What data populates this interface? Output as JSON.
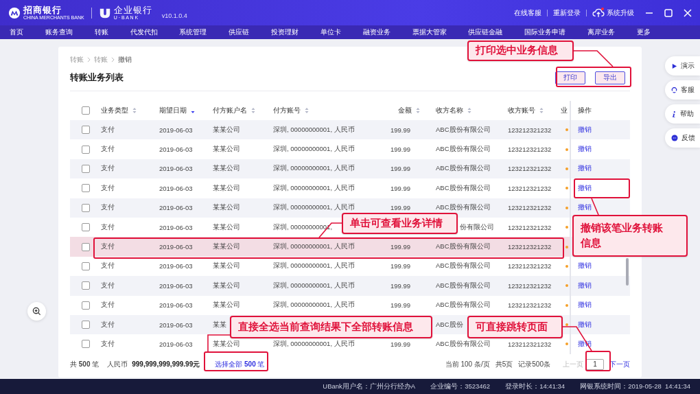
{
  "header": {
    "bank_name": "招商银行",
    "bank_sub": "CHINA MERCHANTS BANK",
    "product": "企业银行",
    "product_sub": "U · B A N K",
    "version": "v10.1.0.4",
    "links": [
      "在线客服",
      "重新登录"
    ],
    "upgrade": {
      "label": "系统升级",
      "notice": true
    }
  },
  "nav": [
    "首页",
    "账务查询",
    "转账",
    "代发代扣",
    "系统管理",
    "供应链",
    "投资理财",
    "单位卡",
    "融资业务",
    "票据大管家",
    "供应链金融",
    "国际业务申请",
    "离岸业务",
    "更多"
  ],
  "breadcrumb": [
    {
      "label": "转账",
      "current": false
    },
    {
      "label": "转账",
      "current": false
    },
    {
      "label": "撤销",
      "current": true
    }
  ],
  "page_title": "转账业务列表",
  "actions": [
    "打印",
    "导出"
  ],
  "table": {
    "select_all_checked": false,
    "columns": [
      {
        "label": "业务类型",
        "sorted": false
      },
      {
        "label": "期望日期",
        "sorted": true
      },
      {
        "label": "付方账户名",
        "sorted": false
      },
      {
        "label": "付方账号",
        "sorted": false
      },
      {
        "label": "金额",
        "sorted": false
      },
      {
        "label": "收方名称",
        "sorted": false
      },
      {
        "label": "收方账号",
        "sorted": false
      },
      {
        "label": "业"
      },
      {
        "label": "操作"
      }
    ],
    "rows": [
      {
        "type": "支付",
        "date": "2019-06-03",
        "payer_name": "某某公司",
        "payer_account": "深圳, 00000000001, 人民币",
        "amount": "199.99",
        "payee_name": "ABC股份有限公司",
        "payee_account": "123212321232",
        "color": "#f5a02a",
        "action": "撤销",
        "checked": false,
        "selected": false
      },
      {
        "type": "支付",
        "date": "2019-06-03",
        "payer_name": "某某公司",
        "payer_account": "深圳, 00000000001, 人民币",
        "amount": "199.99",
        "payee_name": "ABC股份有限公司",
        "payee_account": "123212321232",
        "color": "#f5a02a",
        "action": "撤销",
        "checked": false,
        "selected": false
      },
      {
        "type": "支付",
        "date": "2019-06-03",
        "payer_name": "某某公司",
        "payer_account": "深圳, 00000000001, 人民币",
        "amount": "199.99",
        "payee_name": "ABC股份有限公司",
        "payee_account": "123212321232",
        "color": "#f5a02a",
        "action": "撤销",
        "checked": false,
        "selected": false
      },
      {
        "type": "支付",
        "date": "2019-06-03",
        "payer_name": "某某公司",
        "payer_account": "深圳, 00000000001, 人民币",
        "amount": "199.99",
        "payee_name": "ABC股份有限公司",
        "payee_account": "123212321232",
        "color": "#f5a02a",
        "action": "撤销",
        "checked": false,
        "selected": false
      },
      {
        "type": "支付",
        "date": "2019-06-03",
        "payer_name": "某某公司",
        "payer_account": "深圳, 00000000001, 人民币",
        "amount": "199.99",
        "payee_name": "ABC股份有限公司",
        "payee_account": "123212321232",
        "color": "#f5a02a",
        "action": "撤销",
        "checked": false,
        "selected": false
      },
      {
        "type": "支付",
        "date": "2019-06-03",
        "payer_name": "某某公司",
        "payer_account": "深圳, 00000000001,",
        "payee_name": "份有限公司",
        "payee_name_cut_left": true,
        "payee_account": "123212321232",
        "color": "#f5a02a",
        "checked": false,
        "selected": false
      },
      {
        "type": "支付",
        "date": "2019-06-03",
        "payer_name": "某某公司",
        "payer_account": "深圳, 00000000001, 人民币",
        "amount": "199.99",
        "payee_name": "ABC股份有限公司",
        "payee_account": "123212321232",
        "color": "#f5a02a",
        "checked": false,
        "selected": true
      },
      {
        "type": "支付",
        "date": "2019-06-03",
        "payer_name": "某某公司",
        "payer_account": "深圳, 00000000001, 人民币",
        "amount": "199.99",
        "payee_name": "ABC股份有限公司",
        "payee_account": "123212321232",
        "color": "#f5a02a",
        "action": "撤销",
        "checked": false,
        "selected": false
      },
      {
        "type": "支付",
        "date": "2019-06-03",
        "payer_name": "某某公司",
        "payer_account": "深圳, 00000000001, 人民币",
        "amount": "199.99",
        "payee_name": "ABC股份有限公司",
        "payee_account": "123212321232",
        "color": "#f5a02a",
        "action": "撤销",
        "checked": false,
        "selected": false
      },
      {
        "type": "支付",
        "date": "2019-06-03",
        "payer_name": "某某公司",
        "payer_account": "深圳, 00000000001, 人民币",
        "amount": "199.99",
        "payee_name": "ABC股份有限公司",
        "payee_account": "123212321232",
        "color": "#f5a02a",
        "action": "撤销",
        "checked": false,
        "selected": false
      },
      {
        "type": "支付",
        "date": "2019-06-03",
        "payer_name": "某某",
        "payee_name": "ABC股份",
        "color": "#f5a02a",
        "action": "撤销",
        "checked": false,
        "selected": false
      },
      {
        "type": "支付",
        "date": "2019-06-03",
        "payer_name": "某某公司",
        "payer_account": "深圳, 00000000001, 人民币",
        "amount": "199.99",
        "payee_name": "ABC股份有限公司",
        "payee_account": "123212321232",
        "color": "#f5a02a",
        "action": "撤销",
        "checked": false,
        "selected": false
      }
    ]
  },
  "summary": {
    "count": "共 **500** 笔",
    "currency": "人民币",
    "total": "999,999,999,999.99元",
    "select_all": "选择全部 **500** 笔"
  },
  "pagination": {
    "per_page": "当前 100 条/页",
    "pages": "共5页",
    "records": "记录500条",
    "prev": "上一页",
    "prev_disabled": true,
    "page": "1",
    "next": "下一页"
  },
  "side_buttons": [
    {
      "kind": "play",
      "label": "演示"
    },
    {
      "kind": "service",
      "label": "客服"
    },
    {
      "kind": "info",
      "label": "帮助"
    },
    {
      "kind": "chat",
      "label": "反馈"
    }
  ],
  "annotations": [
    {
      "text": "打印选中业务信息"
    },
    {
      "text": "单击可查看业务详情"
    },
    {
      "text": "撤销该笔业务转账信息"
    },
    {
      "text": "直接全选当前查询结果下全部转账信息"
    },
    {
      "text": "可直接跳转页面"
    }
  ],
  "status_bar": [
    "UBank用户名：广州分行经办A",
    "企业编号：3523462",
    "登录时长：14:41:34",
    "网银系统时间：2019-05-28  14:41:34"
  ]
}
